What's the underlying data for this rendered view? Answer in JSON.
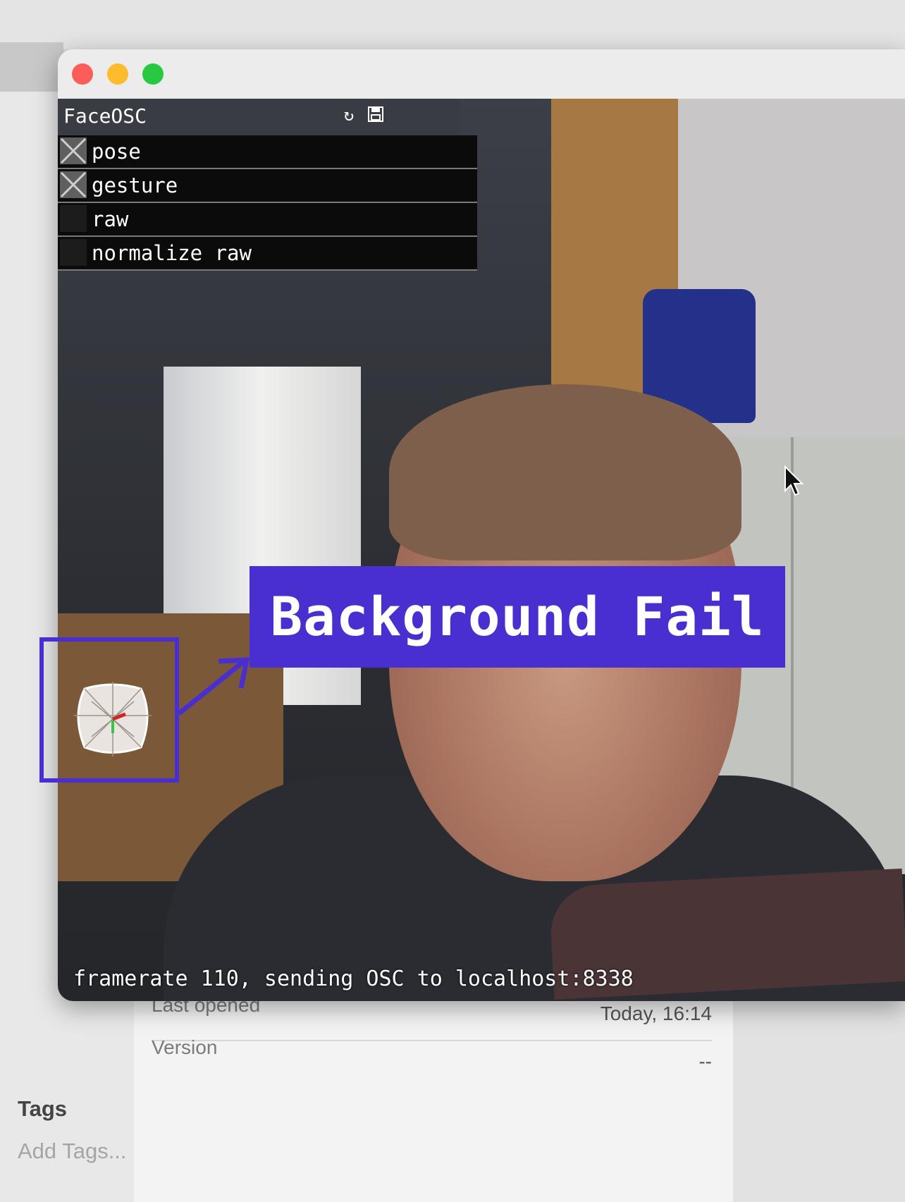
{
  "app": {
    "title": "FaceOSC",
    "options": [
      {
        "label": "pose",
        "checked": true
      },
      {
        "label": "gesture",
        "checked": true
      },
      {
        "label": "raw",
        "checked": false
      },
      {
        "label": "normalize raw",
        "checked": false
      }
    ],
    "status": "framerate 110, sending OSC to localhost:8338",
    "icons": [
      "refresh-icon",
      "save-icon"
    ]
  },
  "annotation": {
    "label": "Background Fail",
    "color": "#4a2fd0"
  },
  "info": {
    "last_opened_label": "Last opened",
    "last_opened_value": "Today, 16:14",
    "version_label": "Version",
    "version_value": "--",
    "tags_heading": "Tags",
    "tags_placeholder": "Add Tags..."
  }
}
